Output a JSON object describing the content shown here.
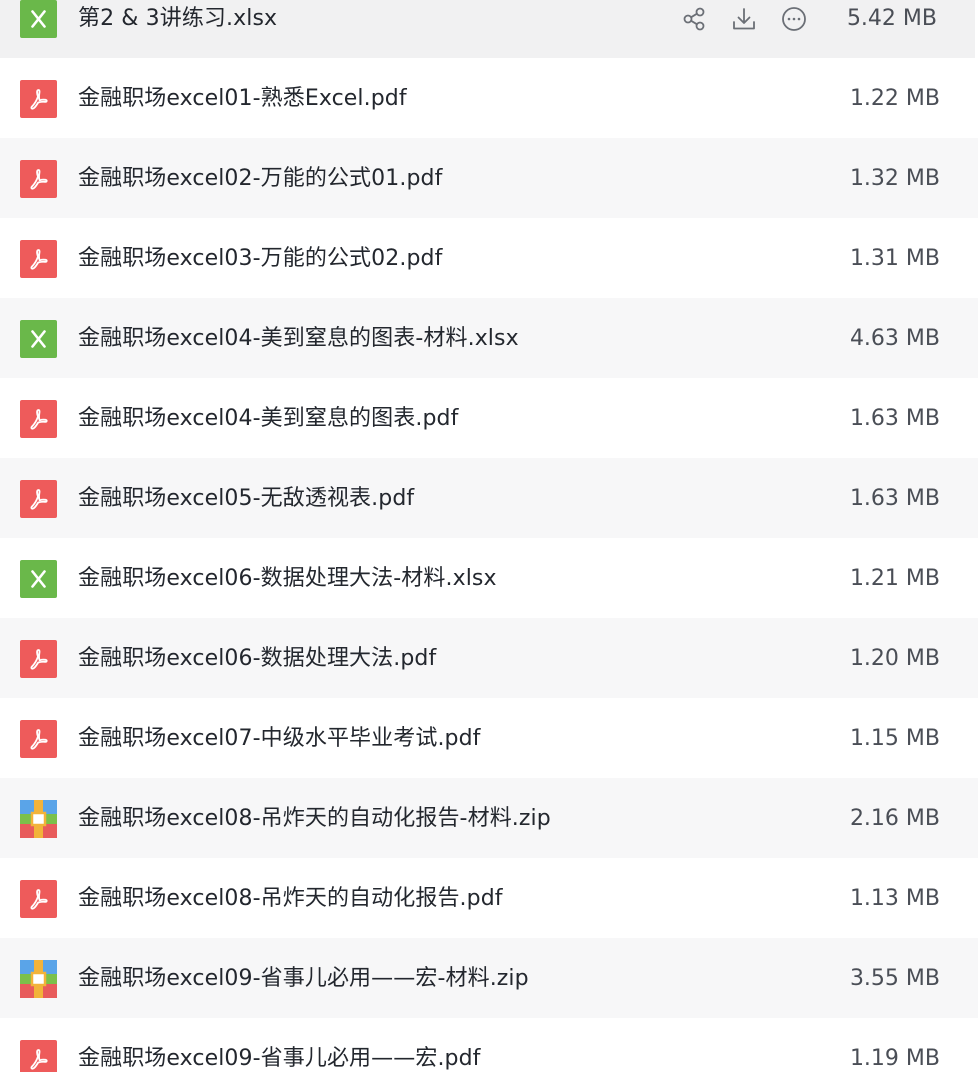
{
  "colors": {
    "pdf": "#ee5b5b",
    "xlsx": "#6ab84a",
    "zip_stripe_left": "#5aa4e8",
    "zip_stripe_right": "#f2b33a",
    "zip_body": "#7bc04a",
    "row_alt_bg": "#f7f7f8",
    "hover_bg": "#f1f1f2",
    "text": "#23272e",
    "size_text": "#4a4e56",
    "action_icon": "#6b6f76"
  },
  "actions": {
    "share_icon": "share-icon",
    "download_icon": "download-icon",
    "more_icon": "more-icon"
  },
  "files": [
    {
      "name": "第2 & 3讲练习.xlsx",
      "size": "5.42 MB",
      "type": "xlsx",
      "icon": "excel-file-icon",
      "hovered": true
    },
    {
      "name": "金融职场excel01-熟悉Excel.pdf",
      "size": "1.22 MB",
      "type": "pdf",
      "icon": "pdf-file-icon"
    },
    {
      "name": "金融职场excel02-万能的公式01.pdf",
      "size": "1.32 MB",
      "type": "pdf",
      "icon": "pdf-file-icon"
    },
    {
      "name": "金融职场excel03-万能的公式02.pdf",
      "size": "1.31 MB",
      "type": "pdf",
      "icon": "pdf-file-icon"
    },
    {
      "name": "金融职场excel04-美到窒息的图表-材料.xlsx",
      "size": "4.63 MB",
      "type": "xlsx",
      "icon": "excel-file-icon"
    },
    {
      "name": "金融职场excel04-美到窒息的图表.pdf",
      "size": "1.63 MB",
      "type": "pdf",
      "icon": "pdf-file-icon"
    },
    {
      "name": "金融职场excel05-无敌透视表.pdf",
      "size": "1.63 MB",
      "type": "pdf",
      "icon": "pdf-file-icon"
    },
    {
      "name": "金融职场excel06-数据处理大法-材料.xlsx",
      "size": "1.21 MB",
      "type": "xlsx",
      "icon": "excel-file-icon"
    },
    {
      "name": "金融职场excel06-数据处理大法.pdf",
      "size": "1.20 MB",
      "type": "pdf",
      "icon": "pdf-file-icon"
    },
    {
      "name": "金融职场excel07-中级水平毕业考试.pdf",
      "size": "1.15 MB",
      "type": "pdf",
      "icon": "pdf-file-icon"
    },
    {
      "name": "金融职场excel08-吊炸天的自动化报告-材料.zip",
      "size": "2.16 MB",
      "type": "zip",
      "icon": "zip-file-icon"
    },
    {
      "name": "金融职场excel08-吊炸天的自动化报告.pdf",
      "size": "1.13 MB",
      "type": "pdf",
      "icon": "pdf-file-icon"
    },
    {
      "name": "金融职场excel09-省事儿必用——宏-材料.zip",
      "size": "3.55 MB",
      "type": "zip",
      "icon": "zip-file-icon"
    },
    {
      "name": "金融职场excel09-省事儿必用——宏.pdf",
      "size": "1.19 MB",
      "type": "pdf",
      "icon": "pdf-file-icon"
    }
  ]
}
